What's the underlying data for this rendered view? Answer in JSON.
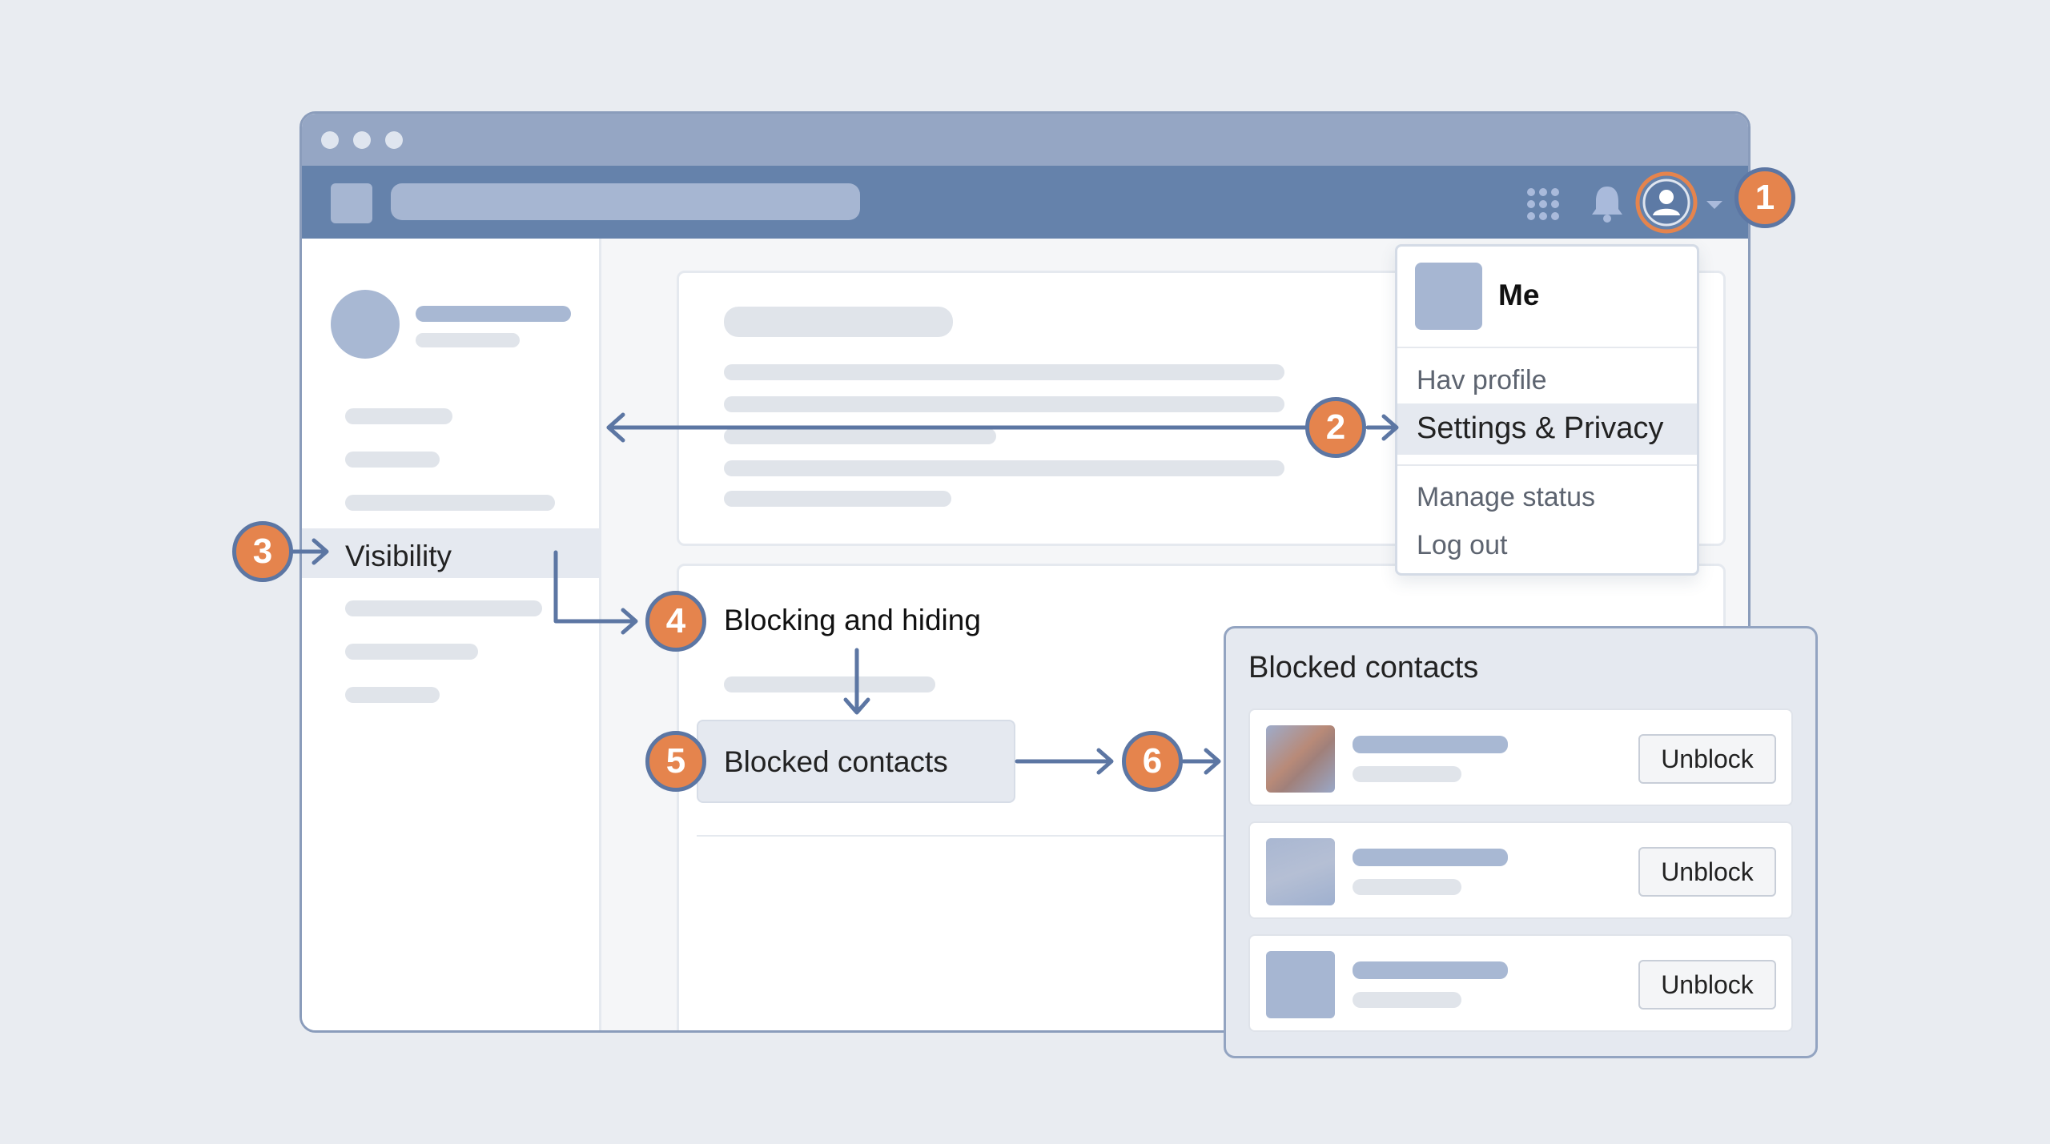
{
  "menu": {
    "name": "Me",
    "items": [
      "Hav profile",
      "Settings & Privacy",
      "Manage status",
      "Log out"
    ]
  },
  "sidebar": {
    "visibility_label": "Visibility"
  },
  "steps": {
    "numbers": [
      "1",
      "2",
      "3",
      "4",
      "5",
      "6"
    ],
    "blocking_label": "Blocking and hiding",
    "blocked_label": "Blocked contacts"
  },
  "panel": {
    "title": "Blocked contacts",
    "unblock_label": "Unblock"
  },
  "colors": {
    "accent": "#e5844d",
    "navy": "#5c76a3",
    "appbar": "#6582ab",
    "titlebar": "#95a6c4"
  },
  "icons": [
    "apps-grid-icon",
    "bell-icon",
    "user-avatar-icon",
    "caret-down-icon"
  ]
}
